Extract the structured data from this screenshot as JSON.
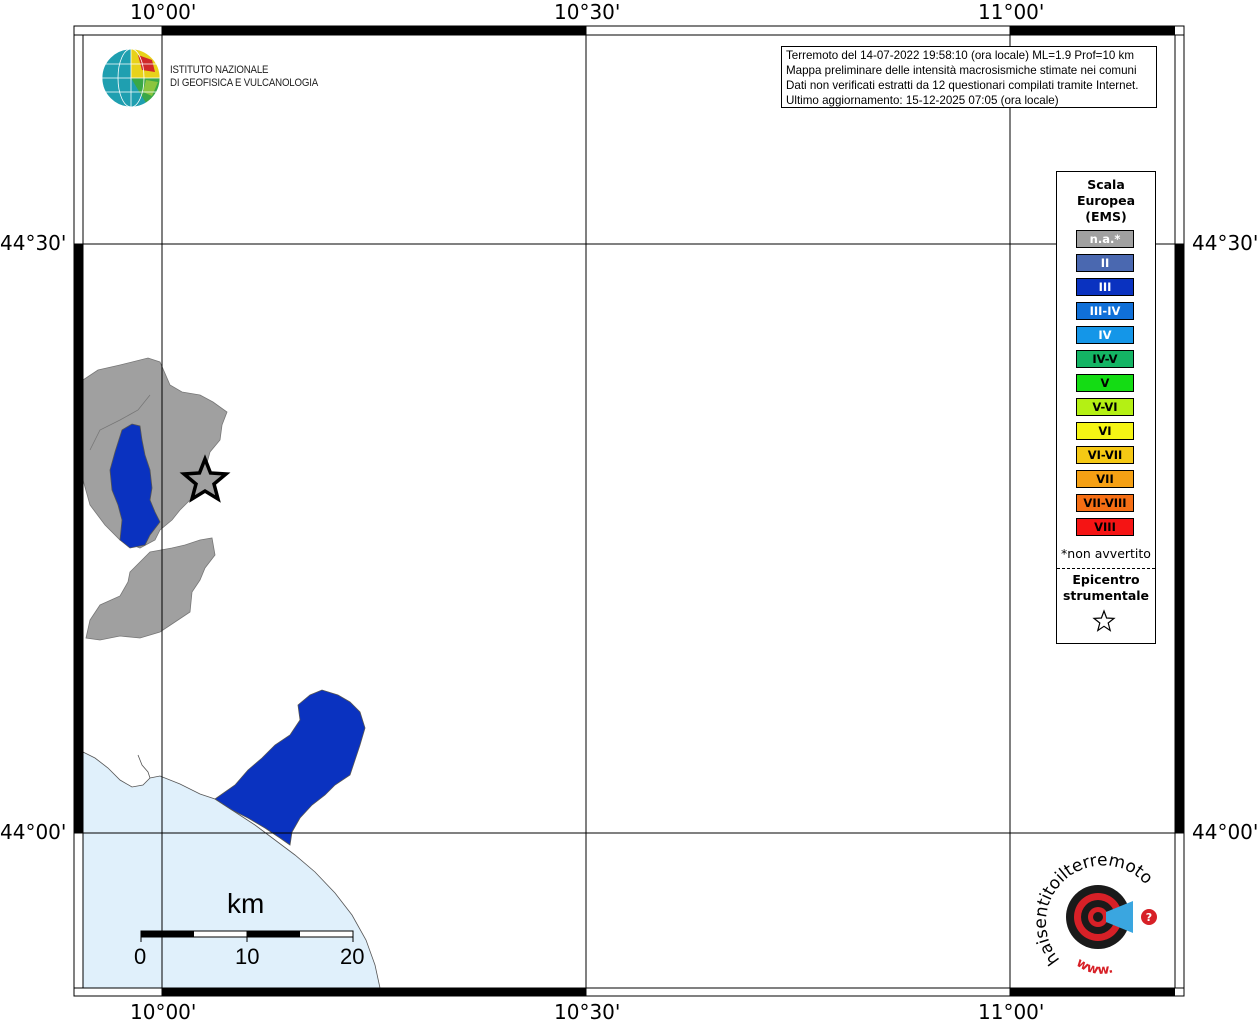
{
  "axes": {
    "top_labels": [
      "10°00'",
      "10°30'",
      "11°00'"
    ],
    "bottom_labels": [
      "10°00'",
      "10°30'",
      "11°00'"
    ],
    "left_labels": [
      "44°30'",
      "44°00'"
    ],
    "right_labels": [
      "44°30'",
      "44°00'"
    ]
  },
  "header": {
    "institute_line1": "ISTITUTO NAZIONALE",
    "institute_line2": "DI GEOFISICA E VULCANOLOGIA"
  },
  "info": {
    "line1": "Terremoto del 14-07-2022 19:58:10 (ora locale) ML=1.9 Prof=10 km",
    "line2": "Mappa preliminare delle intensità macrosismiche stimate nei comuni",
    "line3": "Dati non verificati estratti da 12 questionari compilati tramite Internet.",
    "line4": "Ultimo aggiornamento: 15-12-2025 07:05 (ora locale)"
  },
  "legend": {
    "title_line1": "Scala",
    "title_line2": "Europea",
    "title_line3": "(EMS)",
    "items": [
      {
        "label": "n.a.*",
        "color": "#a0a0a0",
        "text_color": "#ffffff"
      },
      {
        "label": "II",
        "color": "#4a68b0",
        "text_color": "#ffffff"
      },
      {
        "label": "III",
        "color": "#0a32c0",
        "text_color": "#ffffff"
      },
      {
        "label": "III-IV",
        "color": "#1070d8",
        "text_color": "#ffffff"
      },
      {
        "label": "IV",
        "color": "#1496e8",
        "text_color": "#ffffff"
      },
      {
        "label": "IV-V",
        "color": "#14b464",
        "text_color": "#000000"
      },
      {
        "label": "V",
        "color": "#14dc14",
        "text_color": "#000000"
      },
      {
        "label": "V-VI",
        "color": "#b4f014",
        "text_color": "#000000"
      },
      {
        "label": "VI",
        "color": "#f5f514",
        "text_color": "#000000"
      },
      {
        "label": "VI-VII",
        "color": "#f5c814",
        "text_color": "#000000"
      },
      {
        "label": "VII",
        "color": "#f5a014",
        "text_color": "#000000"
      },
      {
        "label": "VII-VIII",
        "color": "#f56e14",
        "text_color": "#000000"
      },
      {
        "label": "VIII",
        "color": "#f51414",
        "text_color": "#000000"
      }
    ],
    "note": "*non avvertito",
    "epicenter_line1": "Epicentro",
    "epicenter_line2": "strumentale"
  },
  "scale_bar": {
    "unit": "km",
    "labels": [
      "0",
      "10",
      "20"
    ]
  },
  "logo_hsit": {
    "text": "haisentitoilterremoto.it",
    "www": "www."
  },
  "colors": {
    "sea": "#e0f0fb",
    "na_gray": "#a0a0a0",
    "intensity_iii": "#0a32c0"
  }
}
